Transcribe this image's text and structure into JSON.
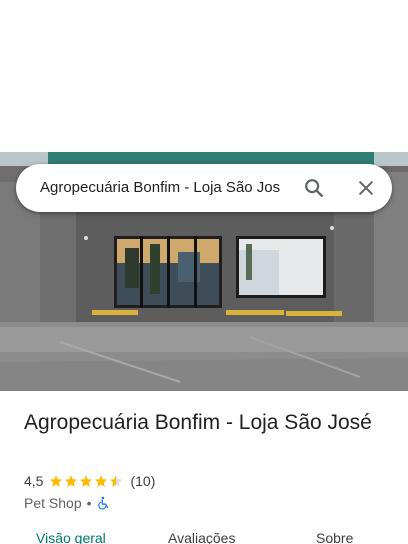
{
  "search": {
    "value": "Agropecuária Bonfim - Loja São Jos",
    "search_icon": "search-icon",
    "close_icon": "close-icon"
  },
  "place": {
    "title": "Agropecuária Bonfim - Loja São José",
    "rating": "4,5",
    "stars": 4.5,
    "review_count": "(10)",
    "category": "Pet Shop",
    "separator": "•",
    "accessibility_icon": "wheelchair-icon"
  },
  "tabs": [
    {
      "label": "Visão geral",
      "active": true
    },
    {
      "label": "Avaliações",
      "active": false
    },
    {
      "label": "Sobre",
      "active": false
    }
  ],
  "colors": {
    "star": "#fbbc04",
    "active_tab": "#00796b",
    "accessibility": "#1a73e8"
  }
}
